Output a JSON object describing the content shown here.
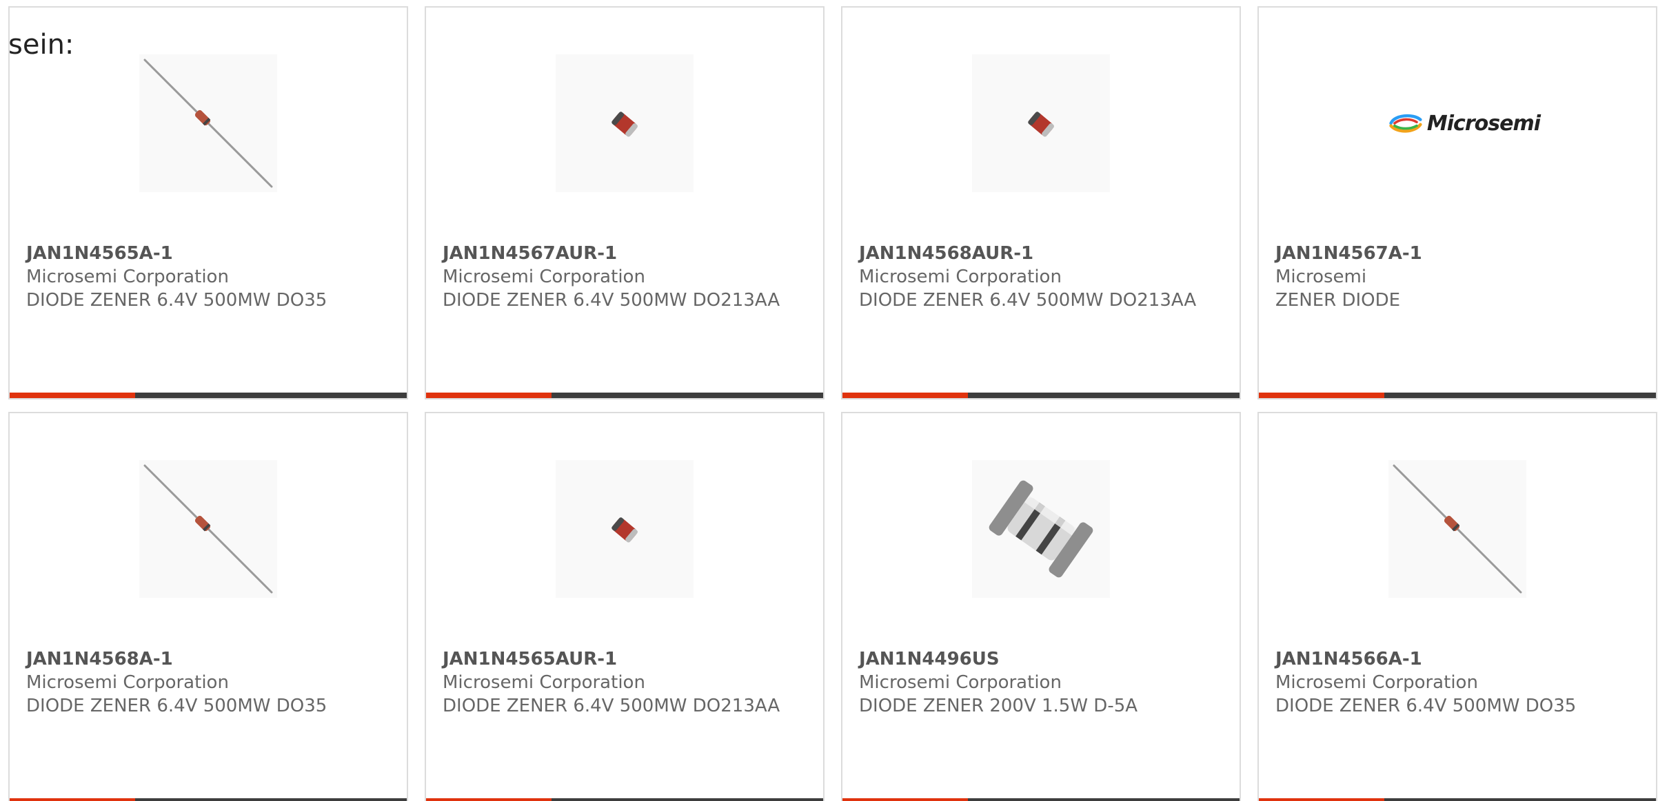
{
  "lead_text": "sein:",
  "colors": {
    "accent": "#e0330e",
    "bar": "#3d3d3d",
    "border": "#dcdcdc",
    "text": "#666666"
  },
  "cards": [
    {
      "part_number": "JAN1N4565A-1",
      "manufacturer": "Microsemi Corporation",
      "description": "DIODE ZENER 6.4V 500MW DO35",
      "image": "axial-diode-icon"
    },
    {
      "part_number": "JAN1N4567AUR-1",
      "manufacturer": "Microsemi Corporation",
      "description": "DIODE ZENER 6.4V 500MW DO213AA",
      "image": "melf-diode-icon"
    },
    {
      "part_number": "JAN1N4568AUR-1",
      "manufacturer": "Microsemi Corporation",
      "description": "DIODE ZENER 6.4V 500MW DO213AA",
      "image": "melf-diode-icon"
    },
    {
      "part_number": "JAN1N4567A-1",
      "manufacturer": "Microsemi",
      "description": "ZENER DIODE",
      "image": "microsemi-logo",
      "logo_text": "Microsemi"
    },
    {
      "part_number": "JAN1N4568A-1",
      "manufacturer": "Microsemi Corporation",
      "description": "DIODE ZENER 6.4V 500MW DO35",
      "image": "axial-diode-icon"
    },
    {
      "part_number": "JAN1N4565AUR-1",
      "manufacturer": "Microsemi Corporation",
      "description": "DIODE ZENER 6.4V 500MW DO213AA",
      "image": "melf-diode-icon"
    },
    {
      "part_number": "JAN1N4496US",
      "manufacturer": "Microsemi Corporation",
      "description": "DIODE ZENER 200V 1.5W D-5A",
      "image": "d5a-diode-icon"
    },
    {
      "part_number": "JAN1N4566A-1",
      "manufacturer": "Microsemi Corporation",
      "description": "DIODE ZENER 6.4V 500MW DO35",
      "image": "axial-diode-icon"
    }
  ]
}
